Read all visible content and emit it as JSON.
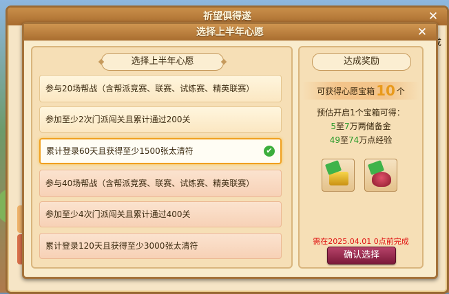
{
  "outer_window": {
    "title": "祈望俱得遂",
    "close_glyph": "✕",
    "side_text": "成"
  },
  "modal": {
    "title": "选择上半年心愿",
    "close_glyph": "✕"
  },
  "wishes": {
    "header": "选择上半年心愿",
    "items": [
      {
        "text": "参与20场帮战（含帮派竞赛、联赛、试炼赛、精英联赛）",
        "selected": false
      },
      {
        "text": "参加至少2次门派闯关且累计通过200关",
        "selected": false
      },
      {
        "text": "累计登录60天且获得至少1500张太清符",
        "selected": true
      },
      {
        "text": "参与40场帮战（含帮派竞赛、联赛、试炼赛、精英联赛）",
        "selected": false
      },
      {
        "text": "参加至少4次门派闯关且累计通过400关",
        "selected": false
      },
      {
        "text": "累计登录120天且获得至少3000张太清符",
        "selected": false
      }
    ],
    "check_glyph": "✔"
  },
  "reward": {
    "header": "达成奖励",
    "box_prefix": "可获得心愿宝箱",
    "box_count": "10",
    "box_suffix": "个",
    "estimate": "预估开启1个宝箱可得：",
    "silver": {
      "from": "5",
      "mid": "至",
      "to": "7",
      "unit": "万两储备金"
    },
    "exp": {
      "from": "49",
      "mid": "至",
      "to": "74",
      "unit": "万点经验"
    },
    "items": [
      "gold-ingot-icon",
      "red-pouch-icon"
    ],
    "deadline": "需在2025.04.01 0点前完成",
    "confirm_label": "确认选择"
  },
  "colors": {
    "accent": "#e89a1c",
    "green": "#2a9a2a",
    "deadline": "#e01010",
    "button": "#9c2a50"
  }
}
